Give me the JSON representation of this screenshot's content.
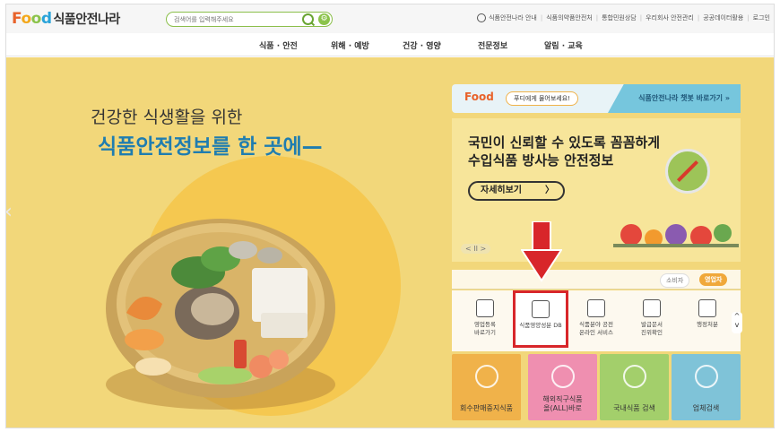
{
  "header": {
    "logo_f": "F",
    "logo_o1": "o",
    "logo_o2": "o",
    "logo_d": "d",
    "logo_kr": "식품안전나라",
    "search_placeholder": "검색어를 입력해주세요",
    "util": [
      "식품안전나라 안내",
      "식품의약품안전처",
      "통합민원상담",
      "우리회사 안전관리",
      "공공데이터활용",
      "로그인"
    ]
  },
  "nav": [
    "식품 · 안전",
    "위해 · 예방",
    "건강 · 영양",
    "전문정보",
    "알림 · 교육"
  ],
  "hero": {
    "line1": "건강한 식생활을 위한",
    "line2": "식품안전정보를 한 곳에—"
  },
  "chat": {
    "logo": "Food",
    "ask": "푸디에게 물어보세요!",
    "link": "식품안전나라 챗봇 바로가기 »"
  },
  "banner": {
    "line1": "국민이 신뢰할 수 있도록 꼼꼼하게",
    "line2": "수입식품 방사능 안전정보",
    "button": "자세히보기",
    "button_arrow": "〉",
    "pager": "< II >"
  },
  "tabs": [
    "소비자",
    "영업자"
  ],
  "services": [
    {
      "label": "영업등록\n바로가기",
      "icon": "registration-icon"
    },
    {
      "label": "식품영양성분 DB",
      "icon": "database-icon"
    },
    {
      "label": "식품분야 공전\n온라인 서비스",
      "icon": "book-icon"
    },
    {
      "label": "발급문서\n진위확인",
      "icon": "document-check-icon"
    },
    {
      "label": "행정처분",
      "icon": "alarm-icon"
    }
  ],
  "scroll": [
    "^",
    "v"
  ],
  "tiles": [
    {
      "label": "회수판매중지식품",
      "color": "#f0b24a"
    },
    {
      "label": "해외직구식품\n올(ALL)바로",
      "color": "#ef8fb0"
    },
    {
      "label": "국내식품 검색",
      "color": "#a3cf6b"
    },
    {
      "label": "업체검색",
      "color": "#7fc3d8"
    }
  ],
  "colors": {
    "hero_bg": "#f2d77a",
    "accent_blue": "#1f7db0",
    "highlight_red": "#d8262a"
  }
}
